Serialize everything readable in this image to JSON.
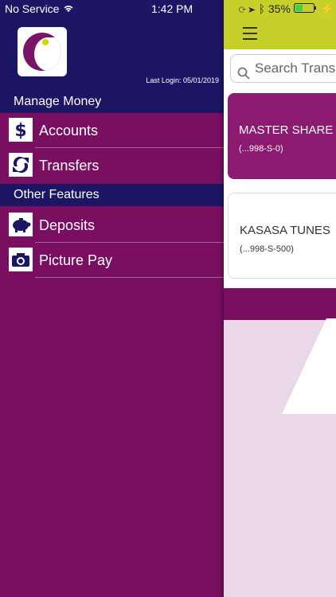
{
  "status_bar": {
    "carrier": "No Service",
    "time": "1:42 PM",
    "battery": "35%"
  },
  "menu": {
    "last_login": "Last Login:  05/01/2019",
    "section1": "Manage Money",
    "section2": "Other Features",
    "items": [
      {
        "label": "Accounts",
        "icon": "dollar-icon"
      },
      {
        "label": "Transfers",
        "icon": "transfer-icon"
      },
      {
        "label": "Deposits",
        "icon": "piggy-bank-icon"
      },
      {
        "label": "Picture Pay",
        "icon": "camera-icon"
      }
    ]
  },
  "content": {
    "search_placeholder": "Search Transactions",
    "accounts": [
      {
        "name": "MASTER SHARE",
        "number": "(...998-S-0)"
      },
      {
        "name": "KASASA TUNES",
        "number": "(...998-S-500)"
      }
    ]
  },
  "colors": {
    "primary": "#7a0f62",
    "header_navy": "#1c1664",
    "accent_lime": "#c7cf2b"
  }
}
